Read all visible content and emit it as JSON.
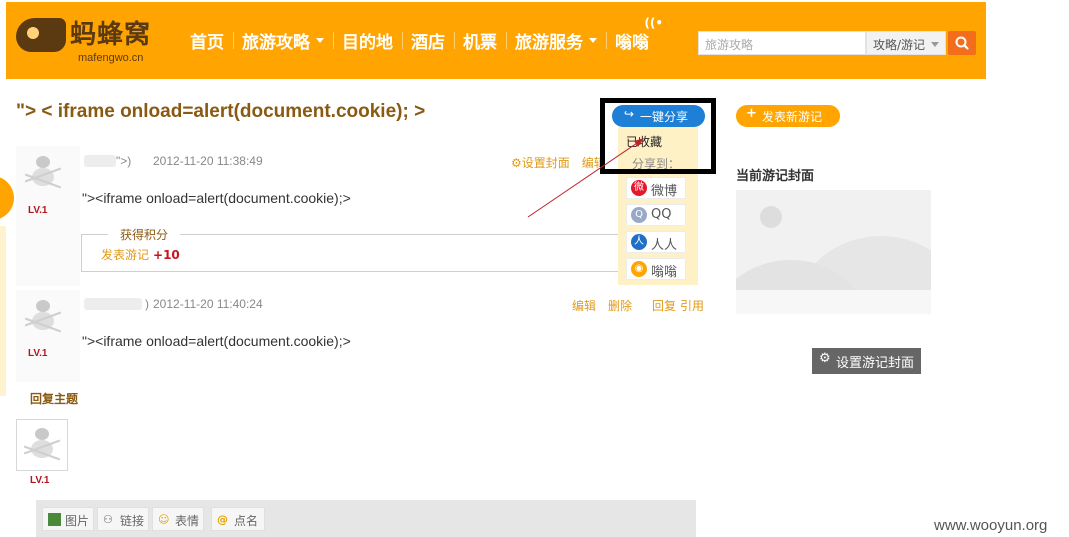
{
  "header": {
    "logo_text": "蚂蜂窝",
    "logo_sub": "mafengwo.cn",
    "nav": [
      {
        "label": "首页",
        "dropdown": false
      },
      {
        "label": "旅游攻略",
        "dropdown": true
      },
      {
        "label": "目的地",
        "dropdown": false
      },
      {
        "label": "酒店",
        "dropdown": false
      },
      {
        "label": "机票",
        "dropdown": false
      },
      {
        "label": "旅游服务",
        "dropdown": true
      },
      {
        "label": "嗡嗡",
        "dropdown": false
      }
    ],
    "search_placeholder": "旅游攻略",
    "search_scope": "攻略/游记",
    "colors": {
      "bar": "#ffa400",
      "search_button": "#f46d1b"
    }
  },
  "page": {
    "title": "\"> < iframe onload=alert(document.cookie); >"
  },
  "posts": [
    {
      "level": "LV.1",
      "timestamp": "2012-11-20 11:38:49",
      "author_suffix": "\">)",
      "actions": [
        "设置封面",
        "编辑"
      ],
      "body": "\"><iframe onload=alert(document.cookie);>",
      "points_title": "获得积分",
      "points_label": "发表游记",
      "points_value": "+10"
    },
    {
      "level": "LV.1",
      "timestamp": "2012-11-20 11:40:24",
      "author_suffix": ")",
      "actions": [
        "编辑",
        "删除",
        "回复",
        "引用"
      ],
      "body": "\"><iframe onload=alert(document.cookie);>"
    }
  ],
  "share": {
    "button": "一键分享",
    "collected": "已收藏",
    "share_to": "分享到：",
    "targets": [
      {
        "label": "微博",
        "icon": "weibo-icon",
        "color": "#e6162d"
      },
      {
        "label": "QQ",
        "icon": "qq-icon",
        "color": "#9aa8c8"
      },
      {
        "label": "人人",
        "icon": "renren-icon",
        "color": "#1f6fc6"
      },
      {
        "label": "嗡嗡",
        "icon": "wengweng-icon",
        "color": "#ffa400"
      }
    ]
  },
  "sidebar": {
    "new_note": "发表新游记",
    "cover_title": "当前游记封面",
    "set_cover": "设置游记封面"
  },
  "reply": {
    "title": "回复主题",
    "level": "LV.1",
    "tools": [
      "图片",
      "链接",
      "表情",
      "点名"
    ]
  },
  "watermark": "www.wooyun.org"
}
